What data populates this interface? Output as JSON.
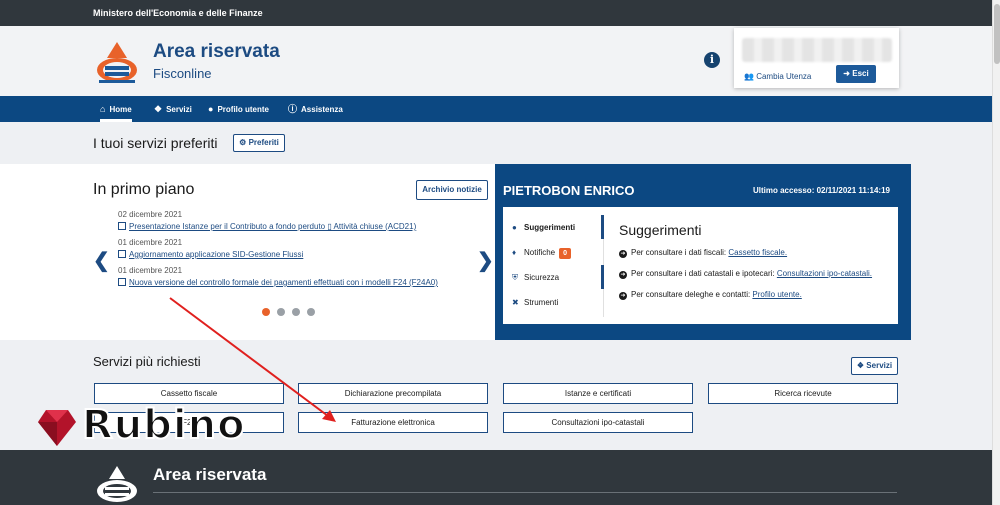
{
  "topbar": {
    "text": "Ministero dell'Economia e delle Finanze"
  },
  "header": {
    "title": "Area riservata",
    "subtitle": "Fisconline",
    "info_icon": "i",
    "user": {
      "cambia_label": "Cambia Utenza",
      "esci_label": "Esci"
    }
  },
  "nav": {
    "items": [
      {
        "label": "Home",
        "icon": "home-icon",
        "active": true
      },
      {
        "label": "Servizi",
        "icon": "cubes-icon"
      },
      {
        "label": "Profilo utente",
        "icon": "user-icon"
      },
      {
        "label": "Assistenza",
        "icon": "info-icon"
      }
    ]
  },
  "favorites": {
    "title": "I tuoi servizi preferiti",
    "button_label": "Preferiti"
  },
  "primo_piano": {
    "title": "In primo piano",
    "archive_label": "Archivio notizie",
    "news": [
      {
        "date": "02 dicembre 2021",
        "link": "Presentazione Istanze per il Contributo a fondo perduto ▯ Attività chiuse (ACD21)"
      },
      {
        "date": "01 dicembre 2021",
        "link": "Aggiornamento applicazione SID-Gestione Flussi"
      },
      {
        "date": "01 dicembre 2021",
        "link": "Nuova versione del controllo formale dei pagamenti effettuati con i modelli F24 (F24A0)"
      }
    ],
    "carousel_count": 4,
    "carousel_active": 0
  },
  "panel": {
    "user_name": "PIETROBON ENRICO",
    "last_access": "Ultimo accesso: 02/11/2021 11:14:19",
    "tabs": [
      {
        "label": "Suggerimenti",
        "icon": "lightbulb-icon",
        "selected": true
      },
      {
        "label": "Notifiche",
        "icon": "bell-icon",
        "badge": "0"
      },
      {
        "label": "Sicurezza",
        "icon": "shield-icon"
      },
      {
        "label": "Strumenti",
        "icon": "tools-icon"
      }
    ],
    "sugg_title": "Suggerimenti",
    "suggestions": [
      {
        "text": "Per consultare i dati fiscali: ",
        "link": "Cassetto fiscale."
      },
      {
        "text": "Per consultare i dati catastali e ipotecari: ",
        "link": "Consultazioni ipo-catastali."
      },
      {
        "text": "Per consultare deleghe e contatti: ",
        "link": "Profilo utente."
      }
    ]
  },
  "servizi": {
    "title": "Servizi più richiesti",
    "button_label": "Servizi",
    "items": [
      "Cassetto fiscale",
      "Dichiarazione precompilata",
      "Istanze e certificati",
      "Ricerca ricevute",
      "F24",
      "Fatturazione elettronica",
      "Consultazioni ipo-catastali"
    ]
  },
  "footer": {
    "title": "Area riservata"
  },
  "watermark": {
    "text": "Rubino"
  },
  "colors": {
    "navy": "#0c4882",
    "dark": "#30373d",
    "accent": "#e8622a"
  }
}
